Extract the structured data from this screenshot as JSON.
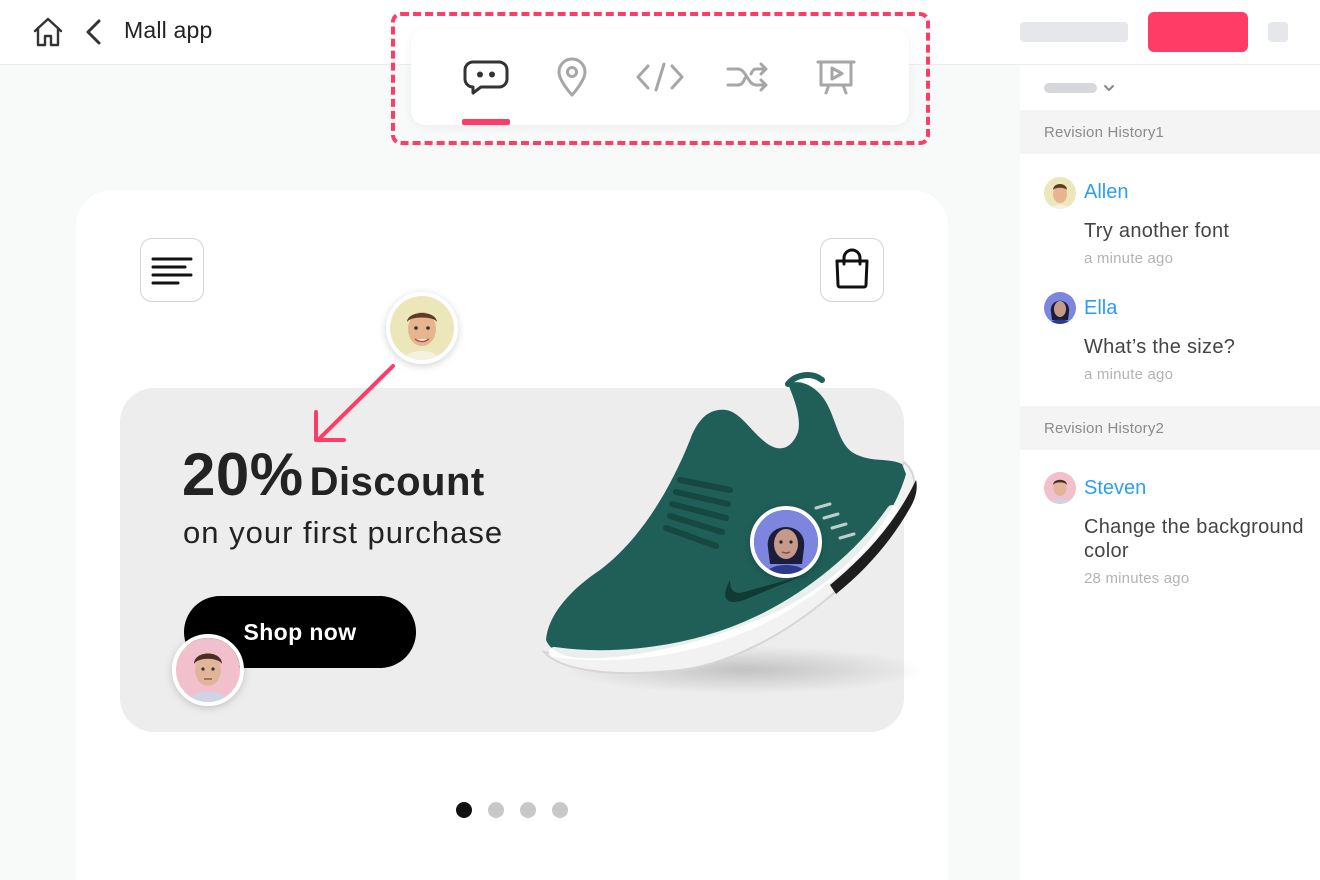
{
  "header": {
    "title": "Mall app",
    "accent_color": "#ff3c66"
  },
  "toolbar": {
    "tools": [
      {
        "name": "comment-icon",
        "active": true
      },
      {
        "name": "location-pin-icon",
        "active": false
      },
      {
        "name": "code-icon",
        "active": false
      },
      {
        "name": "shuffle-icon",
        "active": false
      },
      {
        "name": "presentation-icon",
        "active": false
      }
    ]
  },
  "banner": {
    "percent": "20%",
    "word": "Discount",
    "subtitle": "on your first purchase",
    "cta": "Shop now",
    "shoe_color": "#1f5f58"
  },
  "carousel": {
    "total": 4,
    "active": 1
  },
  "panel": {
    "groups": [
      {
        "title": "Revision History1",
        "comments": [
          {
            "author": "Allen",
            "text": "Try another font",
            "time": "a minute ago"
          },
          {
            "author": "Ella",
            "text": "What’s the size?",
            "time": "a minute ago"
          }
        ]
      },
      {
        "title": "Revision History2",
        "comments": [
          {
            "author": "Steven",
            "text": "Change the background color",
            "time": "28 minutes ago"
          }
        ]
      }
    ]
  }
}
